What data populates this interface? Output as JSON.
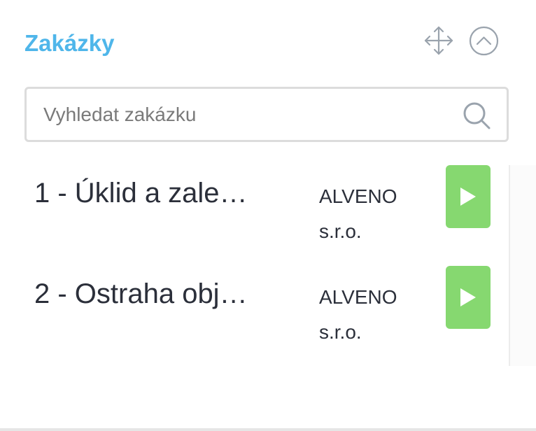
{
  "widget": {
    "title": "Zakázky",
    "move_icon": "move-arrows-icon",
    "collapse_icon": "chevron-up-circle-icon"
  },
  "search": {
    "placeholder": "Vyhledat zakázku",
    "value": "",
    "icon": "search-icon"
  },
  "jobs": [
    {
      "name": "1 - Úklid a zale…",
      "customer": "ALVENO s.r.o.",
      "action_icon": "play-icon"
    },
    {
      "name": "2 - Ostraha obj…",
      "customer": "ALVENO s.r.o.",
      "action_icon": "play-icon"
    }
  ],
  "colors": {
    "title": "#4fb6ea",
    "play_button": "#86d870",
    "text": "#2b2f3a",
    "border": "#dcdcdc",
    "icon": "#9aa3ad"
  }
}
